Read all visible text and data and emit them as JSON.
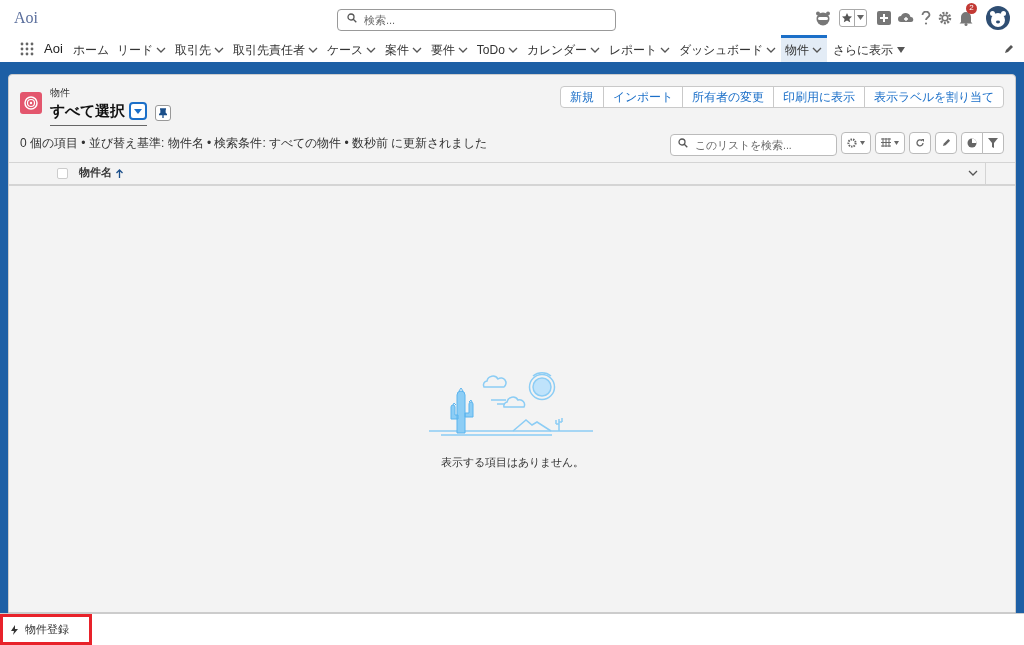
{
  "header": {
    "org": "Aoi",
    "search": {
      "placeholder": "検索..."
    },
    "notification_count": "2"
  },
  "nav": {
    "app_name": "Aoi",
    "items": [
      {
        "label": "ホーム",
        "dropdown": false,
        "selected": false
      },
      {
        "label": "リード",
        "dropdown": true,
        "selected": false
      },
      {
        "label": "取引先",
        "dropdown": true,
        "selected": false
      },
      {
        "label": "取引先責任者",
        "dropdown": true,
        "selected": false
      },
      {
        "label": "ケース",
        "dropdown": true,
        "selected": false
      },
      {
        "label": "案件",
        "dropdown": true,
        "selected": false
      },
      {
        "label": "要件",
        "dropdown": true,
        "selected": false
      },
      {
        "label": "ToDo",
        "dropdown": true,
        "selected": false
      },
      {
        "label": "カレンダー",
        "dropdown": true,
        "selected": false
      },
      {
        "label": "レポート",
        "dropdown": true,
        "selected": false
      },
      {
        "label": "ダッシュボード",
        "dropdown": true,
        "selected": false
      },
      {
        "label": "物件",
        "dropdown": true,
        "selected": true
      }
    ],
    "more": "さらに表示"
  },
  "list_view": {
    "object": "物件",
    "view_name": "すべて選択",
    "actions": [
      "新規",
      "インポート",
      "所有者の変更",
      "印刷用に表示",
      "表示ラベルを割り当て"
    ],
    "status": "0 個の項目 • 並び替え基準: 物件名 • 検索条件: すべての物件 • 数秒前 に更新されました",
    "search": {
      "placeholder": "このリストを検索..."
    },
    "select_all": {
      "checked": false
    },
    "columns": [
      {
        "label": "物件名",
        "sorted": true
      }
    ],
    "empty_message": "表示する項目はありません。"
  },
  "utility_bar": {
    "items": [
      {
        "label": "物件登録",
        "highlighted": true
      }
    ]
  }
}
